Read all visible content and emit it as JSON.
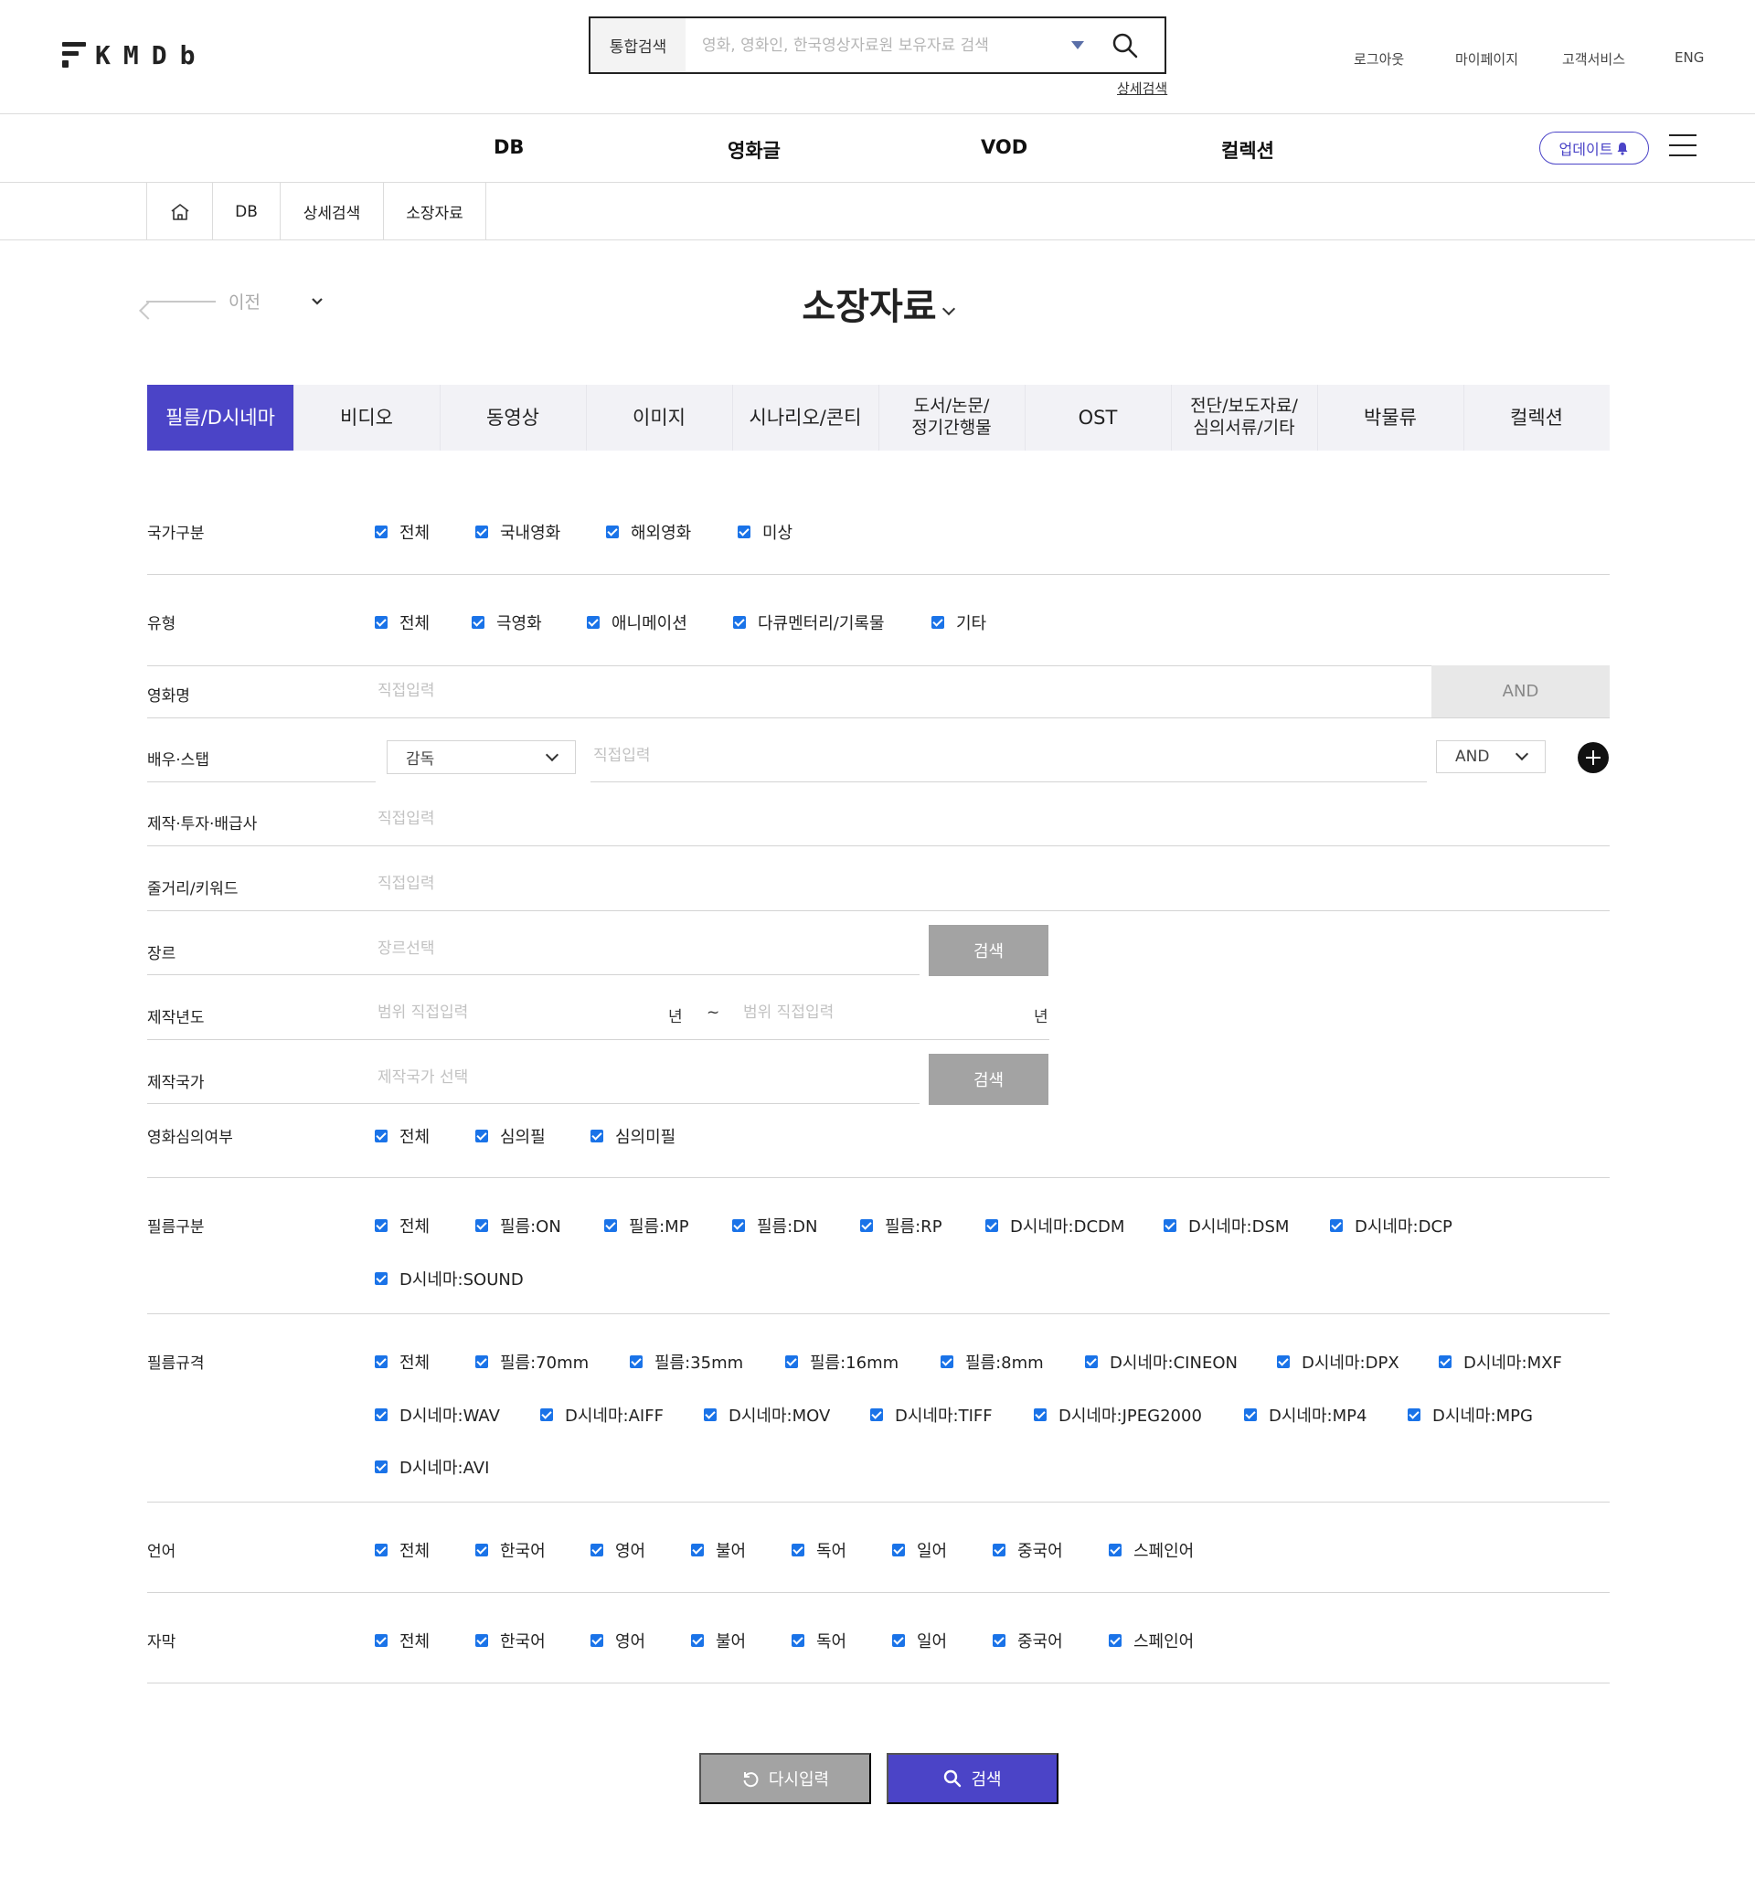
{
  "header": {
    "logo_text": "KMDb",
    "search": {
      "scope": "통합검색",
      "placeholder": "영화, 영화인, 한국영상자료원 보유자료 검색",
      "advanced_link": "상세검색"
    },
    "util_links": [
      "로그아웃",
      "마이페이지",
      "고객서비스",
      "ENG"
    ]
  },
  "gnb": {
    "items": [
      "DB",
      "영화글",
      "VOD",
      "컬렉션"
    ],
    "update_label": "업데이트"
  },
  "breadcrumb": [
    "DB",
    "상세검색",
    "소장자료"
  ],
  "page": {
    "prev_label": "이전",
    "title": "소장자료"
  },
  "tabs": [
    {
      "label": "필름/D시네마",
      "active": true
    },
    {
      "label": "비디오"
    },
    {
      "label": "동영상"
    },
    {
      "label": "이미지"
    },
    {
      "label": "시나리오/콘티"
    },
    {
      "label": "도서/논문/\n정기간행물"
    },
    {
      "label": "OST"
    },
    {
      "label": "전단/보도자료/\n심의서류/기타"
    },
    {
      "label": "박물류"
    },
    {
      "label": "컬렉션"
    }
  ],
  "form": {
    "country_type": {
      "label": "국가구분",
      "options": [
        "전체",
        "국내영화",
        "해외영화",
        "미상"
      ]
    },
    "type": {
      "label": "유형",
      "options": [
        "전체",
        "극영화",
        "애니메이션",
        "다큐멘터리/기록물",
        "기타"
      ]
    },
    "title": {
      "label": "영화명",
      "placeholder": "직접입력",
      "operator": "AND"
    },
    "people": {
      "label": "배우·스탭",
      "role": "감독",
      "placeholder": "직접입력",
      "operator": "AND"
    },
    "company": {
      "label": "제작·투자·배급사",
      "placeholder": "직접입력"
    },
    "keyword": {
      "label": "줄거리/키워드",
      "placeholder": "직접입력"
    },
    "genre": {
      "label": "장르",
      "placeholder": "장르선택",
      "button": "검색"
    },
    "year": {
      "label": "제작년도",
      "from_placeholder": "범위 직접입력",
      "to_placeholder": "범위 직접입력",
      "unit": "년",
      "separator": "~"
    },
    "nation": {
      "label": "제작국가",
      "placeholder": "제작국가 선택",
      "button": "검색"
    },
    "rating": {
      "label": "영화심의여부",
      "options": [
        "전체",
        "심의필",
        "심의미필"
      ]
    },
    "film_kind": {
      "label": "필름구분",
      "options": [
        "전체",
        "필름:ON",
        "필름:MP",
        "필름:DN",
        "필름:RP",
        "D시네마:DCDM",
        "D시네마:DSM",
        "D시네마:DCP",
        "D시네마:SOUND"
      ]
    },
    "film_spec": {
      "label": "필름규격",
      "options": [
        "전체",
        "필름:70mm",
        "필름:35mm",
        "필름:16mm",
        "필름:8mm",
        "D시네마:CINEON",
        "D시네마:DPX",
        "D시네마:MXF",
        "D시네마:WAV",
        "D시네마:AIFF",
        "D시네마:MOV",
        "D시네마:TIFF",
        "D시네마:JPEG2000",
        "D시네마:MP4",
        "D시네마:MPG",
        "D시네마:AVI"
      ]
    },
    "language": {
      "label": "언어",
      "options": [
        "전체",
        "한국어",
        "영어",
        "불어",
        "독어",
        "일어",
        "중국어",
        "스페인어"
      ]
    },
    "subtitle": {
      "label": "자막",
      "options": [
        "전체",
        "한국어",
        "영어",
        "불어",
        "독어",
        "일어",
        "중국어",
        "스페인어"
      ]
    }
  },
  "actions": {
    "reset": "다시입력",
    "search": "검색"
  },
  "colors": {
    "accent": "#4b44c7",
    "checkbox": "#1a73e8",
    "gray_button": "#a3a3a3"
  }
}
